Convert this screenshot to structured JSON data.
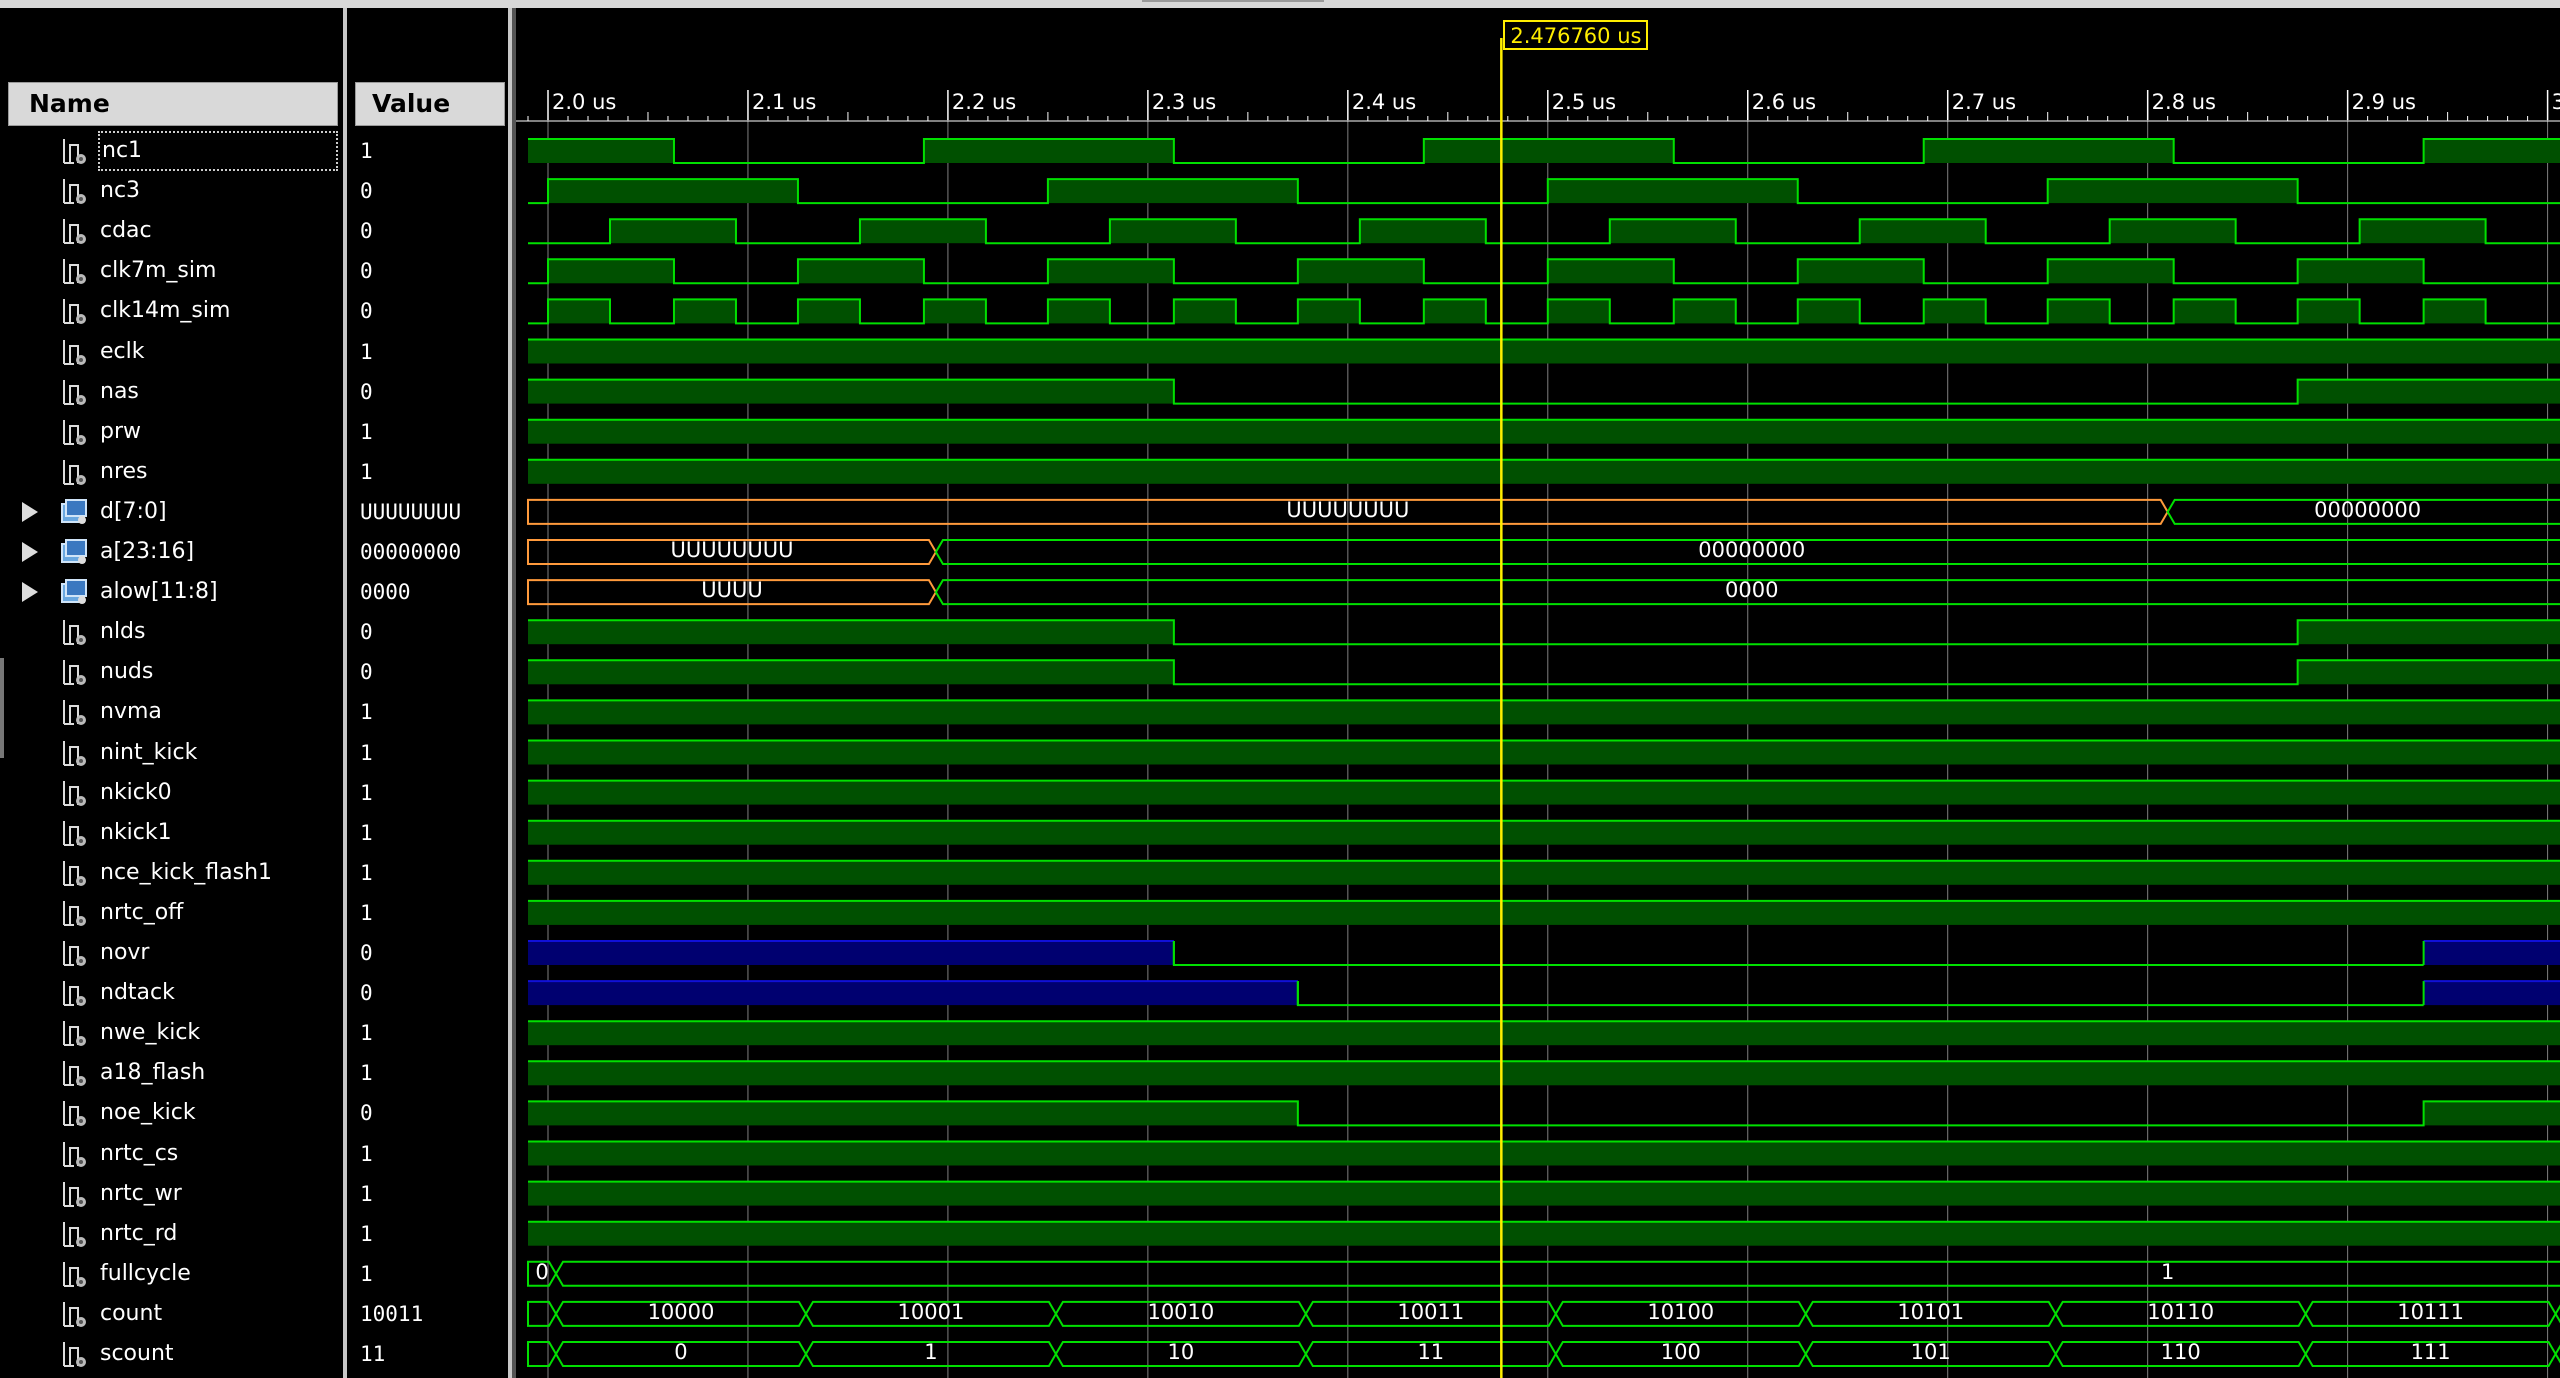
{
  "columns": {
    "name": "Name",
    "value": "Value"
  },
  "cursor": {
    "time_label": "2.476760 us",
    "time_us": 2.47676
  },
  "timeline": {
    "start_us": 1.99,
    "end_us": 3.01,
    "ticks": [
      {
        "t": 2.0,
        "label": "2.0 us"
      },
      {
        "t": 2.1,
        "label": "2.1 us"
      },
      {
        "t": 2.2,
        "label": "2.2 us"
      },
      {
        "t": 2.3,
        "label": "2.3 us"
      },
      {
        "t": 2.4,
        "label": "2.4 us"
      },
      {
        "t": 2.5,
        "label": "2.5 us"
      },
      {
        "t": 2.6,
        "label": "2.6 us"
      },
      {
        "t": 2.7,
        "label": "2.7 us"
      },
      {
        "t": 2.8,
        "label": "2.8 us"
      },
      {
        "t": 2.9,
        "label": "2.9 us"
      },
      {
        "t": 3.0,
        "label": "3"
      }
    ]
  },
  "colors": {
    "wave": "#00e000",
    "wave_fill": "#005000",
    "undefined": "#ff9a3c",
    "highz": "#1010d8",
    "highz_fill": "#000070",
    "cursor": "#ffee00",
    "grid": "#808080",
    "header_bg": "#d9d9d9"
  },
  "signals": [
    {
      "name": "nc1",
      "value": "1",
      "icon": "signal-icon",
      "kind": "bit",
      "init": 1,
      "edges": [
        2.063,
        2.188,
        2.313,
        2.438,
        2.563,
        2.688,
        2.813,
        2.938
      ]
    },
    {
      "name": "nc3",
      "value": "0",
      "icon": "signal-icon",
      "kind": "bit",
      "init": 0,
      "edges": [
        2.0,
        2.125,
        2.25,
        2.375,
        2.5,
        2.625,
        2.75,
        2.875
      ]
    },
    {
      "name": "cdac",
      "value": "0",
      "icon": "signal-icon",
      "kind": "bit",
      "init": 0,
      "edges": [
        2.031,
        2.094,
        2.156,
        2.219,
        2.281,
        2.344,
        2.406,
        2.469,
        2.531,
        2.594,
        2.656,
        2.719,
        2.781,
        2.844,
        2.906,
        2.969
      ]
    },
    {
      "name": "clk7m_sim",
      "value": "0",
      "icon": "signal-icon",
      "kind": "bit",
      "init": 0,
      "edges": [
        2.0,
        2.063,
        2.125,
        2.188,
        2.25,
        2.313,
        2.375,
        2.438,
        2.5,
        2.563,
        2.625,
        2.688,
        2.75,
        2.813,
        2.875,
        2.938
      ]
    },
    {
      "name": "clk14m_sim",
      "value": "0",
      "icon": "signal-icon",
      "kind": "bit",
      "init": 0,
      "edges": [
        2.0,
        2.031,
        2.063,
        2.094,
        2.125,
        2.156,
        2.188,
        2.219,
        2.25,
        2.281,
        2.313,
        2.344,
        2.375,
        2.406,
        2.438,
        2.469,
        2.5,
        2.531,
        2.563,
        2.594,
        2.625,
        2.656,
        2.688,
        2.719,
        2.75,
        2.781,
        2.813,
        2.844,
        2.875,
        2.906,
        2.938,
        2.969
      ]
    },
    {
      "name": "eclk",
      "value": "1",
      "icon": "signal-icon",
      "kind": "bit",
      "init": 1,
      "edges": []
    },
    {
      "name": "nas",
      "value": "0",
      "icon": "signal-icon",
      "kind": "bit",
      "init": 1,
      "edges": [
        2.313,
        2.875
      ]
    },
    {
      "name": "prw",
      "value": "1",
      "icon": "signal-icon",
      "kind": "bit",
      "init": 1,
      "edges": []
    },
    {
      "name": "nres",
      "value": "1",
      "icon": "signal-icon",
      "kind": "bit",
      "init": 1,
      "edges": []
    },
    {
      "name": "d[7:0]",
      "value": "UUUUUUUU",
      "icon": "bus-icon",
      "kind": "bus",
      "expandable": true,
      "segments": [
        {
          "start": 1.99,
          "end": 2.81,
          "label": "UUUUUUUU",
          "u": true
        },
        {
          "start": 2.81,
          "end": 3.01,
          "label": "00000000",
          "u": false
        }
      ]
    },
    {
      "name": "a[23:16]",
      "value": "00000000",
      "icon": "bus-icon",
      "kind": "bus",
      "expandable": true,
      "segments": [
        {
          "start": 1.99,
          "end": 2.194,
          "label": "UUUUUUUU",
          "u": true
        },
        {
          "start": 2.194,
          "end": 3.01,
          "label": "00000000",
          "u": false
        }
      ]
    },
    {
      "name": "alow[11:8]",
      "value": "0000",
      "icon": "bus-icon",
      "kind": "bus",
      "expandable": true,
      "segments": [
        {
          "start": 1.99,
          "end": 2.194,
          "label": "UUUU",
          "u": true
        },
        {
          "start": 2.194,
          "end": 3.01,
          "label": "0000",
          "u": false
        }
      ]
    },
    {
      "name": "nlds",
      "value": "0",
      "icon": "signal-icon",
      "kind": "bit",
      "init": 1,
      "edges": [
        2.313,
        2.875
      ]
    },
    {
      "name": "nuds",
      "value": "0",
      "icon": "signal-icon",
      "kind": "bit",
      "init": 1,
      "edges": [
        2.313,
        2.875
      ]
    },
    {
      "name": "nvma",
      "value": "1",
      "icon": "signal-icon",
      "kind": "bit",
      "init": 1,
      "edges": []
    },
    {
      "name": "nint_kick",
      "value": "1",
      "icon": "signal-icon",
      "kind": "bit",
      "init": 1,
      "edges": []
    },
    {
      "name": "nkick0",
      "value": "1",
      "icon": "signal-icon",
      "kind": "bit",
      "init": 1,
      "edges": []
    },
    {
      "name": "nkick1",
      "value": "1",
      "icon": "signal-icon",
      "kind": "bit",
      "init": 1,
      "edges": []
    },
    {
      "name": "nce_kick_flash1",
      "value": "1",
      "icon": "signal-icon",
      "kind": "bit",
      "init": 1,
      "edges": []
    },
    {
      "name": "nrtc_off",
      "value": "1",
      "icon": "signal-icon",
      "kind": "bit",
      "init": 1,
      "edges": []
    },
    {
      "name": "novr",
      "value": "0",
      "icon": "signal-icon",
      "kind": "tri",
      "init": "z",
      "edges": [
        2.313,
        2.938
      ]
    },
    {
      "name": "ndtack",
      "value": "0",
      "icon": "signal-icon",
      "kind": "tri",
      "init": "z",
      "edges": [
        2.375,
        2.938
      ]
    },
    {
      "name": "nwe_kick",
      "value": "1",
      "icon": "signal-icon",
      "kind": "bit",
      "init": 1,
      "edges": []
    },
    {
      "name": "a18_flash",
      "value": "1",
      "icon": "signal-icon",
      "kind": "bit",
      "init": 1,
      "edges": []
    },
    {
      "name": "noe_kick",
      "value": "0",
      "icon": "signal-icon",
      "kind": "bit",
      "init": 1,
      "edges": [
        2.375,
        2.938
      ]
    },
    {
      "name": "nrtc_cs",
      "value": "1",
      "icon": "signal-icon",
      "kind": "bit",
      "init": 1,
      "edges": []
    },
    {
      "name": "nrtc_wr",
      "value": "1",
      "icon": "signal-icon",
      "kind": "bit",
      "init": 1,
      "edges": []
    },
    {
      "name": "nrtc_rd",
      "value": "1",
      "icon": "signal-icon",
      "kind": "bit",
      "init": 1,
      "edges": []
    },
    {
      "name": "fullcycle",
      "value": "1",
      "icon": "signal-icon",
      "kind": "bus",
      "expandable": false,
      "segments": [
        {
          "start": 1.99,
          "end": 2.004,
          "label": "0",
          "u": false
        },
        {
          "start": 2.004,
          "end": 3.01,
          "label": "1",
          "u": false,
          "label_t": 2.8
        }
      ]
    },
    {
      "name": "count",
      "value": "10011",
      "icon": "signal-icon",
      "kind": "bus",
      "expandable": false,
      "segments": [
        {
          "start": 1.99,
          "end": 2.004,
          "label": "",
          "u": false
        },
        {
          "start": 2.004,
          "end": 2.129,
          "label": "10000",
          "u": false
        },
        {
          "start": 2.129,
          "end": 2.254,
          "label": "10001",
          "u": false
        },
        {
          "start": 2.254,
          "end": 2.379,
          "label": "10010",
          "u": false
        },
        {
          "start": 2.379,
          "end": 2.504,
          "label": "10011",
          "u": false
        },
        {
          "start": 2.504,
          "end": 2.629,
          "label": "10100",
          "u": false
        },
        {
          "start": 2.629,
          "end": 2.754,
          "label": "10101",
          "u": false
        },
        {
          "start": 2.754,
          "end": 2.879,
          "label": "10110",
          "u": false
        },
        {
          "start": 2.879,
          "end": 3.004,
          "label": "10111",
          "u": false
        },
        {
          "start": 3.004,
          "end": 3.01,
          "label": "",
          "u": false
        }
      ]
    },
    {
      "name": "scount",
      "value": "11",
      "icon": "signal-icon",
      "kind": "bus",
      "expandable": false,
      "segments": [
        {
          "start": 1.99,
          "end": 2.004,
          "label": "",
          "u": false
        },
        {
          "start": 2.004,
          "end": 2.129,
          "label": "0",
          "u": false
        },
        {
          "start": 2.129,
          "end": 2.254,
          "label": "1",
          "u": false
        },
        {
          "start": 2.254,
          "end": 2.379,
          "label": "10",
          "u": false
        },
        {
          "start": 2.379,
          "end": 2.504,
          "label": "11",
          "u": false
        },
        {
          "start": 2.504,
          "end": 2.629,
          "label": "100",
          "u": false
        },
        {
          "start": 2.629,
          "end": 2.754,
          "label": "101",
          "u": false
        },
        {
          "start": 2.754,
          "end": 2.879,
          "label": "110",
          "u": false
        },
        {
          "start": 2.879,
          "end": 3.004,
          "label": "111",
          "u": false
        },
        {
          "start": 3.004,
          "end": 3.01,
          "label": "",
          "u": false
        }
      ]
    }
  ]
}
